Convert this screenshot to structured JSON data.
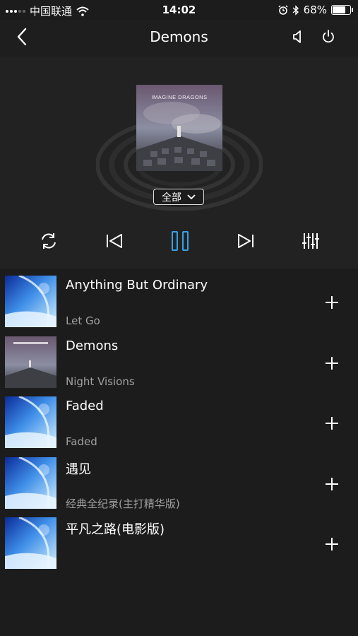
{
  "status_bar": {
    "carrier": "中国联通",
    "time": "14:02",
    "battery_percent": "68%",
    "battery_level": 0.68
  },
  "nav": {
    "title": "Demons",
    "back_icon": "chevron-left-icon",
    "volume_icon": "speaker-icon",
    "power_icon": "power-icon"
  },
  "player": {
    "album_cover_text": "IMAGINE DRAGONS",
    "mode_select": {
      "selected": "全部"
    },
    "controls": [
      {
        "name": "repeat-button",
        "icon": "repeat-icon"
      },
      {
        "name": "previous-button",
        "icon": "skip-previous-icon"
      },
      {
        "name": "pause-button",
        "icon": "pause-icon"
      },
      {
        "name": "next-button",
        "icon": "skip-next-icon"
      },
      {
        "name": "equalizer-button",
        "icon": "equalizer-icon"
      }
    ]
  },
  "songs": [
    {
      "title": "Anything But Ordinary",
      "album": "Let Go",
      "cover": "blue"
    },
    {
      "title": "Demons",
      "album": "Night Visions",
      "cover": "dragons"
    },
    {
      "title": "Faded",
      "album": "Faded",
      "cover": "blue"
    },
    {
      "title": "遇见",
      "album": "经典全纪录(主打精华版)",
      "cover": "blue"
    },
    {
      "title": "平凡之路(电影版)",
      "album": "",
      "cover": "blue"
    }
  ],
  "colors": {
    "background": "#1c1c1c",
    "accent": "#3aa0e6",
    "secondary_text": "#a0a0a0"
  }
}
